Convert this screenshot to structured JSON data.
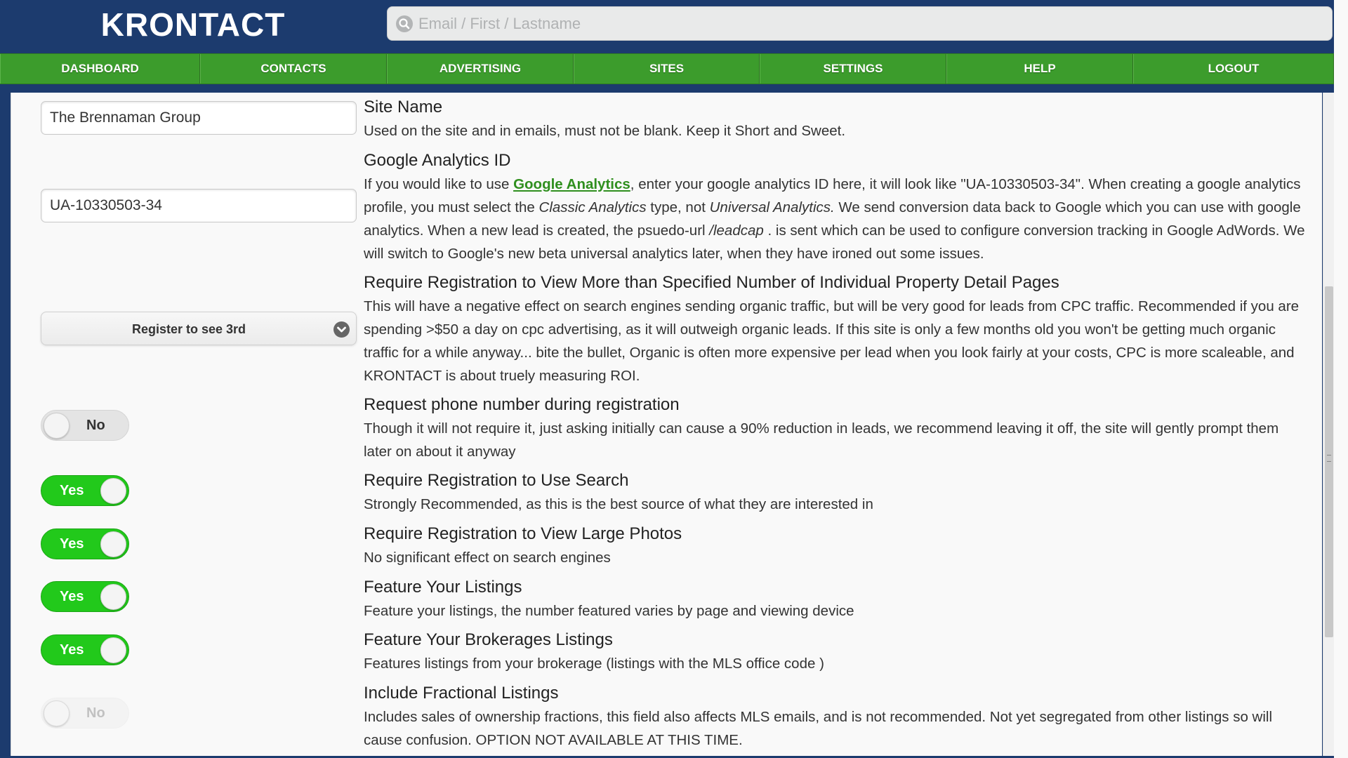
{
  "app": {
    "logo_text": "KRONTACT",
    "colors": {
      "header_bg": "#1c3b6e",
      "nav_green": "#3c9c2c",
      "toggle_on": "#22c91b",
      "link_green": "#2f8f1e"
    }
  },
  "search": {
    "placeholder": "Email / First / Lastname",
    "icon": "search-icon"
  },
  "nav": {
    "items": [
      {
        "label": "DASHBOARD"
      },
      {
        "label": "CONTACTS"
      },
      {
        "label": "ADVERTISING"
      },
      {
        "label": "SITES"
      },
      {
        "label": "SETTINGS"
      },
      {
        "label": "HELP"
      },
      {
        "label": "LOGOUT"
      }
    ]
  },
  "fields": {
    "site_name_value": "The Brennaman Group",
    "ga_id_value": "UA-10330503-34",
    "registration_select_value": "Register to see 3rd"
  },
  "toggles": [
    {
      "label": "No",
      "state": "off"
    },
    {
      "label": "Yes",
      "state": "on"
    },
    {
      "label": "Yes",
      "state": "on"
    },
    {
      "label": "Yes",
      "state": "on"
    },
    {
      "label": "Yes",
      "state": "on"
    },
    {
      "label": "No",
      "state": "disabled"
    }
  ],
  "settings": {
    "site_name": {
      "title": "Site Name",
      "desc": "Used on the site and in emails, must not be blank. Keep it Short and Sweet."
    },
    "google_analytics": {
      "title": "Google Analytics ID",
      "desc_prefix": "If you would like to use ",
      "link_text": "Google Analytics",
      "desc_part1": ", enter your google analytics ID here, it will look like \"UA-10330503-34\". When creating a google analytics profile, you must select the ",
      "em1": "Classic Analytics",
      "desc_part2": " type, not ",
      "em2": "Universal Analytics.",
      "desc_part3": " We send conversion data back to Google which you can use with google analytics. When a new lead is created, the psuedo-url ",
      "em3": "/leadcap",
      "desc_part4": " . is sent which can be used to configure conversion tracking in Google AdWords. We will switch to Google's new beta universal analytics later, when they have ironed out some issues."
    },
    "require_registration_detail": {
      "title": "Require Registration to View More than Specified Number of Individual Property Detail Pages",
      "desc": "This will have a negative effect on search engines sending organic traffic, but will be very good for leads from CPC traffic. Recommended if you are spending >$50 a day on cpc advertising, as it will outweigh organic leads. If this site is only a few months old you won't be getting much organic traffic for a while anyway... bite the bullet, Organic is often more expensive per lead when you look fairly at your costs, CPC is more scaleable, and KRONTACT is about truely measuring ROI."
    },
    "request_phone": {
      "title": "Request phone number during registration",
      "desc": "Though it will not require it, just asking initially can cause a 90% reduction in leads, we recommend leaving it off, the site will gently prompt them later on about it anyway"
    },
    "require_search": {
      "title": "Require Registration to Use Search",
      "desc": "Strongly Recommended, as this is the best source of what they are interested in"
    },
    "require_photos": {
      "title": "Require Registration to View Large Photos",
      "desc": "No significant effect on search engines"
    },
    "feature_listings": {
      "title": "Feature Your Listings",
      "desc": "Feature your listings, the number featured varies by page and viewing device"
    },
    "feature_brokerage": {
      "title": "Feature Your Brokerages Listings",
      "desc": "Features listings from your brokerage (listings with the MLS office code )"
    },
    "fractional": {
      "title": "Include Fractional Listings",
      "desc": "Includes sales of ownership fractions, this field also affects MLS emails, and is not recommended. Not yet segregated from other listings so will cause confusion. OPTION NOT AVAILABLE AT THIS TIME."
    }
  }
}
